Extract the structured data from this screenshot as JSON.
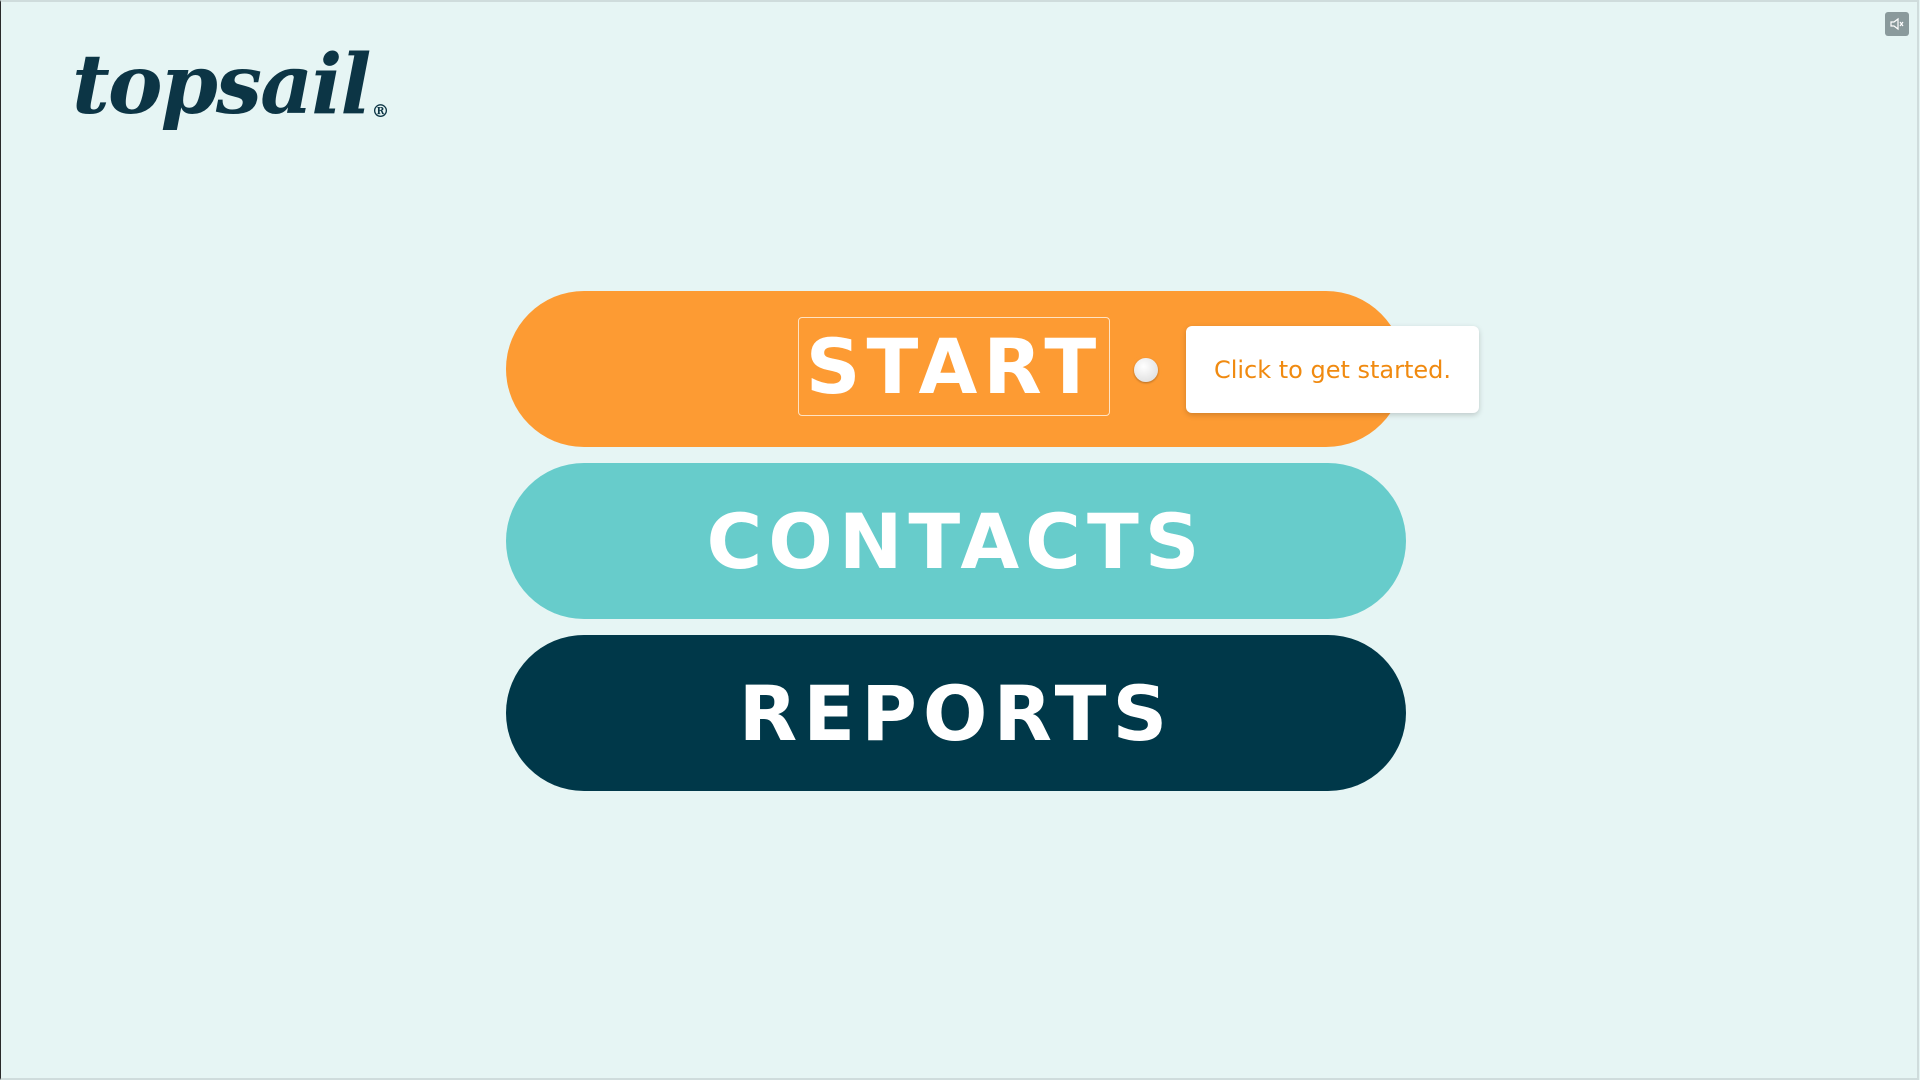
{
  "brand": {
    "logo_text": "topsail",
    "registered_mark": "®"
  },
  "controls": {
    "mute_icon": "speaker-muted-icon"
  },
  "menu": {
    "start_label": "START",
    "contacts_label": "CONTACTS",
    "reports_label": "REPORTS"
  },
  "tooltip": {
    "text": "Click to get started."
  },
  "colors": {
    "background": "#e6f5f4",
    "start": "#fd9b33",
    "contacts": "#67cccb",
    "reports": "#003849",
    "logo": "#0c3545",
    "tooltip_text": "#f08a10"
  }
}
